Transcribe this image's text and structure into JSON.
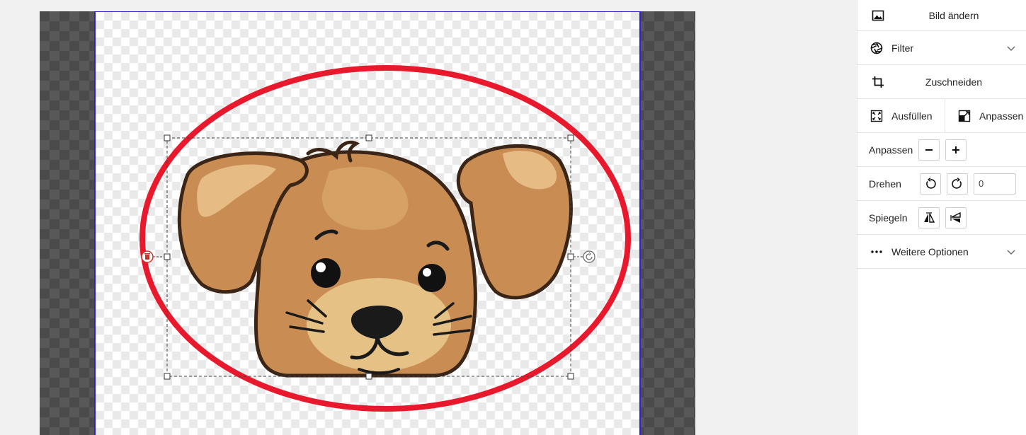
{
  "panel": {
    "change_image": {
      "label": "Bild ändern",
      "icon": "image-icon"
    },
    "filter": {
      "label": "Filter",
      "icon": "aperture-icon",
      "expanded": false
    },
    "crop": {
      "label": "Zuschneiden",
      "icon": "crop-icon"
    },
    "fill": {
      "label": "Ausfüllen",
      "icon": "expand-corners-icon"
    },
    "fit": {
      "label": "Anpassen",
      "icon": "fit-icon"
    },
    "scale": {
      "label": "Anpassen",
      "minus": "−",
      "plus": "+"
    },
    "rotate": {
      "label": "Drehen",
      "value": "0"
    },
    "mirror": {
      "label": "Spiegeln"
    },
    "more": {
      "label": "Weitere Optionen",
      "expanded": false
    }
  },
  "canvas": {
    "frame_color": "#2e1fd0",
    "ellipse_color": "#e8192c",
    "selection_handle_color": "#333333",
    "delete_handle_color": "#c0392b"
  }
}
